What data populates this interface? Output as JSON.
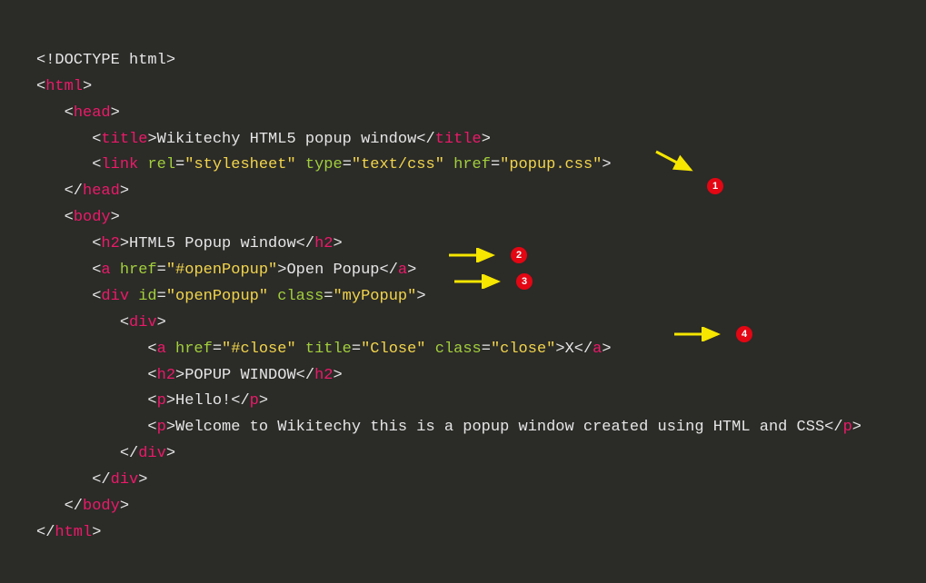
{
  "code": {
    "doctype": "<!DOCTYPE html>",
    "html_open": "html",
    "head_open": "head",
    "title_tag": "title",
    "title_text": "Wikitechy HTML5 popup window",
    "link_tag": "link",
    "link_rel_attr": "rel",
    "link_rel_val": "\"stylesheet\"",
    "link_type_attr": "type",
    "link_type_val": "\"text/css\"",
    "link_href_attr": "href",
    "link_href_val": "\"popup.css\"",
    "head_close": "head",
    "body_open": "body",
    "h2_tag": "h2",
    "h2_text": "HTML5 Popup window",
    "a_tag": "a",
    "a_href_attr": "href",
    "a_open_href_val": "\"#openPopup\"",
    "a_open_text": "Open Popup",
    "div_tag": "div",
    "div_id_attr": "id",
    "div_id_val": "\"openPopup\"",
    "div_class_attr": "class",
    "div_class_val": "\"myPopup\"",
    "close_href_val": "\"#close\"",
    "close_title_attr": "title",
    "close_title_val": "\"Close\"",
    "close_class_val": "\"close\"",
    "close_text": "X",
    "popup_h2_text": "POPUP WINDOW",
    "p_tag": "p",
    "p1_text": "Hello!",
    "p2_text": "Welcome to Wikitechy this is a popup window created using HTML and CSS",
    "body_close": "body",
    "html_close": "html"
  },
  "badges": {
    "b1": "1",
    "b2": "2",
    "b3": "3",
    "b4": "4"
  }
}
